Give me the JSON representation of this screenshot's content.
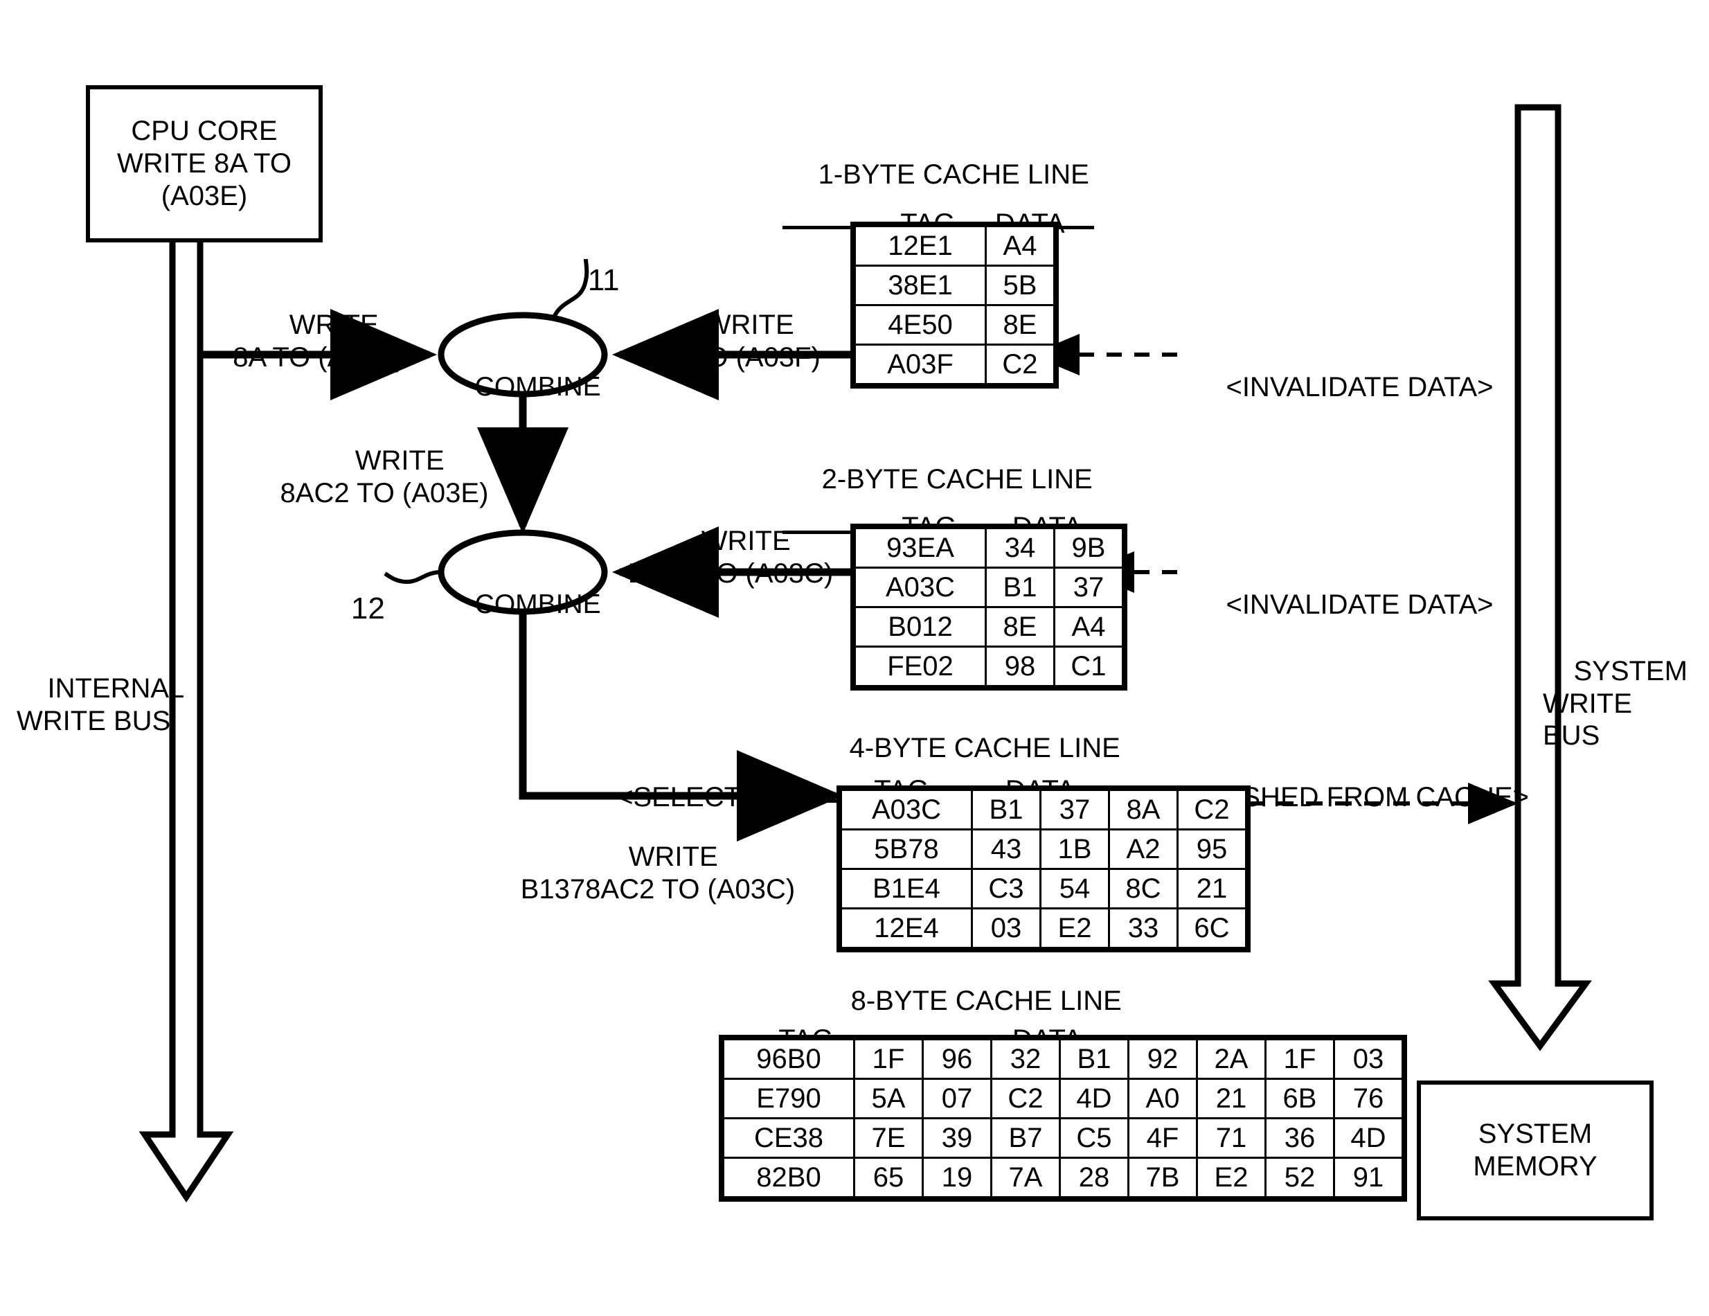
{
  "figure": {
    "cpu_core_box": "CPU CORE\nWRITE\n8A TO (A03E)",
    "system_memory_box": "SYSTEM\nMEMORY",
    "internal_write_bus_label": "INTERNAL\nWRITE BUS",
    "system_write_bus_label": "SYSTEM\nWRITE\nBUS",
    "combine_node_1": {
      "label": "COMBINE",
      "ref": "11"
    },
    "combine_node_2": {
      "label": "COMBINE",
      "ref": "12"
    },
    "edges": {
      "write_8a": "WRITE\n8A TO (A03E)",
      "write_c2": "WRITE\nC2 TO (A03F)",
      "write_8ac2": "WRITE\n8AC2 TO (A03E)",
      "write_b137": "WRITE\nB137 TO (A03C)",
      "select": "<SELECT>",
      "write_b1378ac2": "WRITE\nB1378AC2 TO (A03C)",
      "invalidate_1": "<INVALIDATE DATA>",
      "invalidate_2": "<INVALIDATE DATA>",
      "flushed": "<FLUSHED FROM CACHE>"
    },
    "tables": [
      {
        "title": "1-BYTE CACHE LINE",
        "headers": {
          "tag": "TAG",
          "data": "DATA"
        },
        "rows": [
          {
            "tag": "12E1",
            "data": [
              "A4"
            ]
          },
          {
            "tag": "38E1",
            "data": [
              "5B"
            ]
          },
          {
            "tag": "4E50",
            "data": [
              "8E"
            ]
          },
          {
            "tag": "A03F",
            "data": [
              "C2"
            ]
          }
        ]
      },
      {
        "title": "2-BYTE CACHE LINE",
        "headers": {
          "tag": "TAG",
          "data": "DATA"
        },
        "rows": [
          {
            "tag": "93EA",
            "data": [
              "34",
              "9B"
            ]
          },
          {
            "tag": "A03C",
            "data": [
              "B1",
              "37"
            ]
          },
          {
            "tag": "B012",
            "data": [
              "8E",
              "A4"
            ]
          },
          {
            "tag": "FE02",
            "data": [
              "98",
              "C1"
            ]
          }
        ]
      },
      {
        "title": "4-BYTE CACHE LINE",
        "headers": {
          "tag": "TAG",
          "data": "DATA"
        },
        "rows": [
          {
            "tag": "A03C",
            "data": [
              "B1",
              "37",
              "8A",
              "C2"
            ]
          },
          {
            "tag": "5B78",
            "data": [
              "43",
              "1B",
              "A2",
              "95"
            ]
          },
          {
            "tag": "B1E4",
            "data": [
              "C3",
              "54",
              "8C",
              "21"
            ]
          },
          {
            "tag": "12E4",
            "data": [
              "03",
              "E2",
              "33",
              "6C"
            ]
          }
        ]
      },
      {
        "title": "8-BYTE CACHE LINE",
        "headers": {
          "tag": "TAG",
          "data": "DATA"
        },
        "rows": [
          {
            "tag": "96B0",
            "data": [
              "1F",
              "96",
              "32",
              "B1",
              "92",
              "2A",
              "1F",
              "03"
            ]
          },
          {
            "tag": "E790",
            "data": [
              "5A",
              "07",
              "C2",
              "4D",
              "A0",
              "21",
              "6B",
              "76"
            ]
          },
          {
            "tag": "CE38",
            "data": [
              "7E",
              "39",
              "B7",
              "C5",
              "4F",
              "71",
              "36",
              "4D"
            ]
          },
          {
            "tag": "82B0",
            "data": [
              "65",
              "19",
              "7A",
              "28",
              "7B",
              "E2",
              "52",
              "91"
            ]
          }
        ]
      }
    ],
    "colors": {
      "ink": "#000000",
      "paper": "#ffffff"
    }
  }
}
